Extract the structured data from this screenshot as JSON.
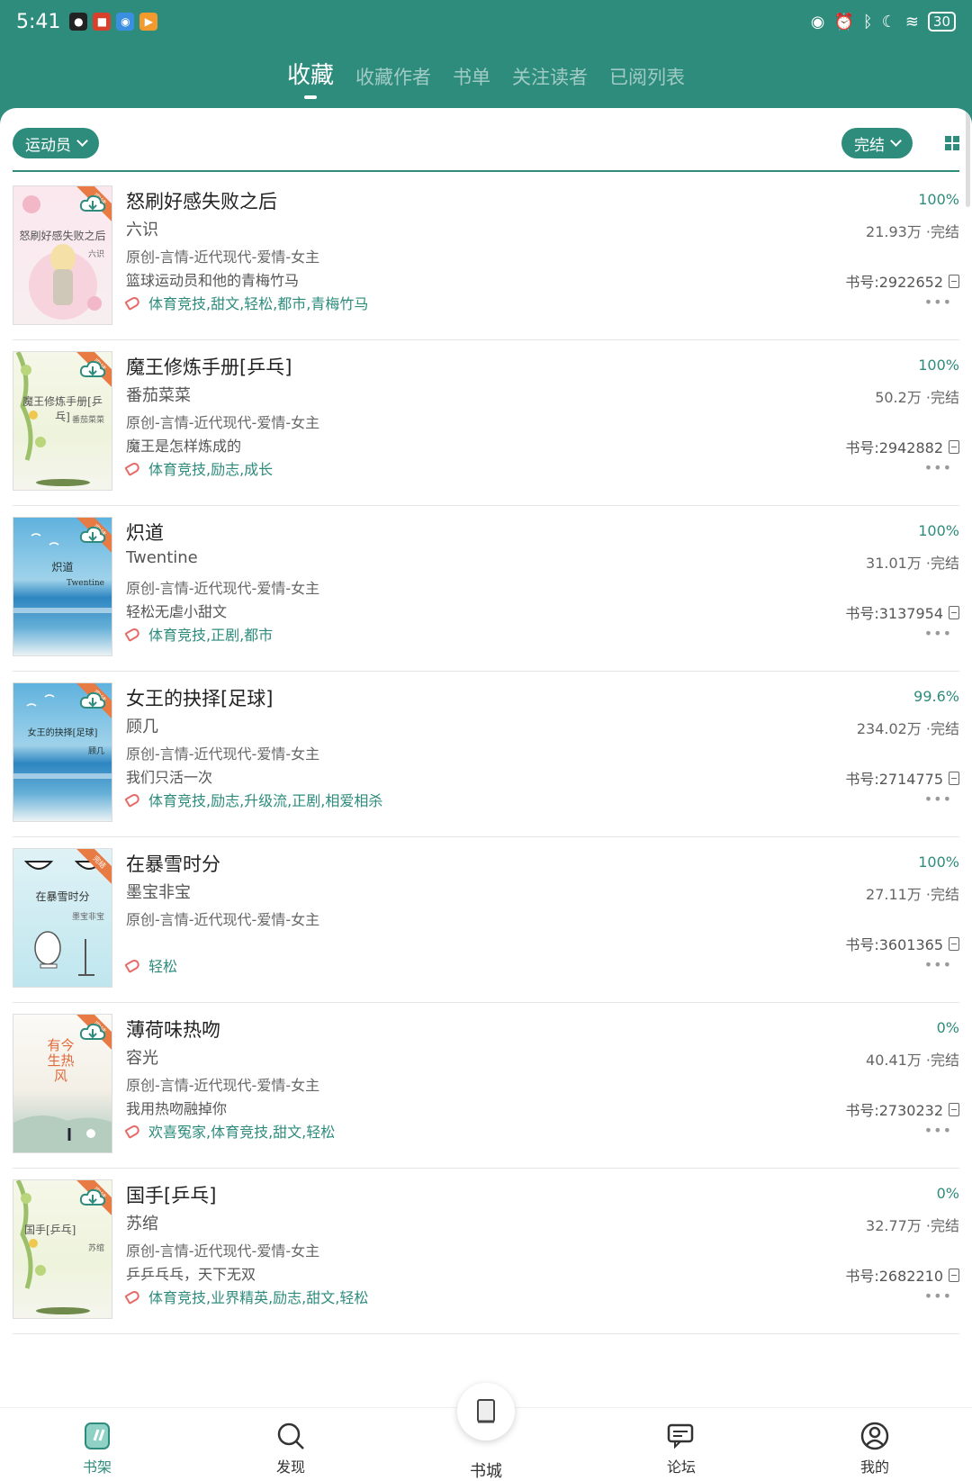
{
  "status_bar": {
    "time": "5:41",
    "battery": "30",
    "left_icons": [
      "qq-icon",
      "app-icon",
      "browser-icon",
      "video-icon"
    ],
    "right_icons": [
      "eye-icon",
      "alarm-icon",
      "bluetooth-icon",
      "moon-icon",
      "wifi-icon"
    ]
  },
  "top_tabs": [
    {
      "label": "收藏",
      "active": true
    },
    {
      "label": "收藏作者",
      "active": false
    },
    {
      "label": "书单",
      "active": false
    },
    {
      "label": "关注读者",
      "active": false
    },
    {
      "label": "已阅列表",
      "active": false
    }
  ],
  "filters": {
    "left": "运动员",
    "right": "完结"
  },
  "books": [
    {
      "title": "怒刷好感失败之后",
      "author": "六识",
      "category": "原创-言情-近代现代-爱情-女主",
      "description": "篮球运动员和他的青梅竹马",
      "tags": "体育竞技,甜文,轻松,都市,青梅竹马",
      "progress": "100%",
      "stats": "21.93万 ·完结",
      "book_id": "书号:2922652",
      "cover": {
        "title": "怒刷好感失败之后",
        "author": "六识",
        "style": "pink"
      }
    },
    {
      "title": "魔王修炼手册[乒乓]",
      "author": "番茄菜菜",
      "category": "原创-言情-近代现代-爱情-女主",
      "description": "魔王是怎样炼成的",
      "tags": "体育竞技,励志,成长",
      "progress": "100%",
      "stats": "50.2万 ·完结",
      "book_id": "书号:2942882",
      "cover": {
        "title": "魔王修炼手册[乒乓]",
        "author": "番茄菜菜",
        "style": "green"
      }
    },
    {
      "title": "炽道",
      "author": "Twentine",
      "category": "原创-言情-近代现代-爱情-女主",
      "description": "轻松无虐小甜文",
      "tags": "体育竞技,正剧,都市",
      "progress": "100%",
      "stats": "31.01万 ·完结",
      "book_id": "书号:3137954",
      "cover": {
        "title": "炽道",
        "author": "Twentine",
        "style": "sea"
      }
    },
    {
      "title": "女王的抉择[足球]",
      "author": "顾几",
      "category": "原创-言情-近代现代-爱情-女主",
      "description": "我们只活一次",
      "tags": "体育竞技,励志,升级流,正剧,相爱相杀",
      "progress": "99.6%",
      "stats": "234.02万 ·完结",
      "book_id": "书号:2714775",
      "cover": {
        "title": "女王的抉择[足球]",
        "author": "顾几",
        "style": "sea"
      }
    },
    {
      "title": "在暴雪时分",
      "author": "墨宝非宝",
      "category": "原创-言情-近代现代-爱情-女主",
      "description": "",
      "tags": "轻松",
      "progress": "100%",
      "stats": "27.11万 ·完结",
      "book_id": "书号:3601365",
      "cover": {
        "title": "在暴雪时分",
        "author": "墨宝非宝",
        "style": "snow"
      }
    },
    {
      "title": "薄荷味热吻",
      "author": "容光",
      "category": "原创-言情-近代现代-爱情-女主",
      "description": "我用热吻融掉你",
      "tags": "欢喜冤家,体育竞技,甜文,轻松",
      "progress": "0%",
      "stats": "40.41万 ·完结",
      "book_id": "书号:2730232",
      "cover": {
        "title": "有今生热风",
        "author": "",
        "style": "warm"
      }
    },
    {
      "title": "国手[乒乓]",
      "author": "苏绾",
      "category": "原创-言情-近代现代-爱情-女主",
      "description": "乒乒乓乓，天下无双",
      "tags": "体育竞技,业界精英,励志,甜文,轻松",
      "progress": "0%",
      "stats": "32.77万 ·完结",
      "book_id": "书号:2682210",
      "cover": {
        "title": "国手[乒乓]",
        "author": "苏绾",
        "style": "green"
      }
    }
  ],
  "bottom_nav": [
    {
      "label": "书架",
      "icon": "bookshelf-icon",
      "active": true
    },
    {
      "label": "发现",
      "icon": "discover-icon",
      "active": false
    },
    {
      "label": "书城",
      "icon": "bookstore-icon",
      "active": false
    },
    {
      "label": "论坛",
      "icon": "forum-icon",
      "active": false
    },
    {
      "label": "我的",
      "icon": "profile-icon",
      "active": false
    }
  ],
  "colors": {
    "accent": "#2e8c7d",
    "tag_icon": "#e86b6b",
    "badge": "#e87a43"
  }
}
